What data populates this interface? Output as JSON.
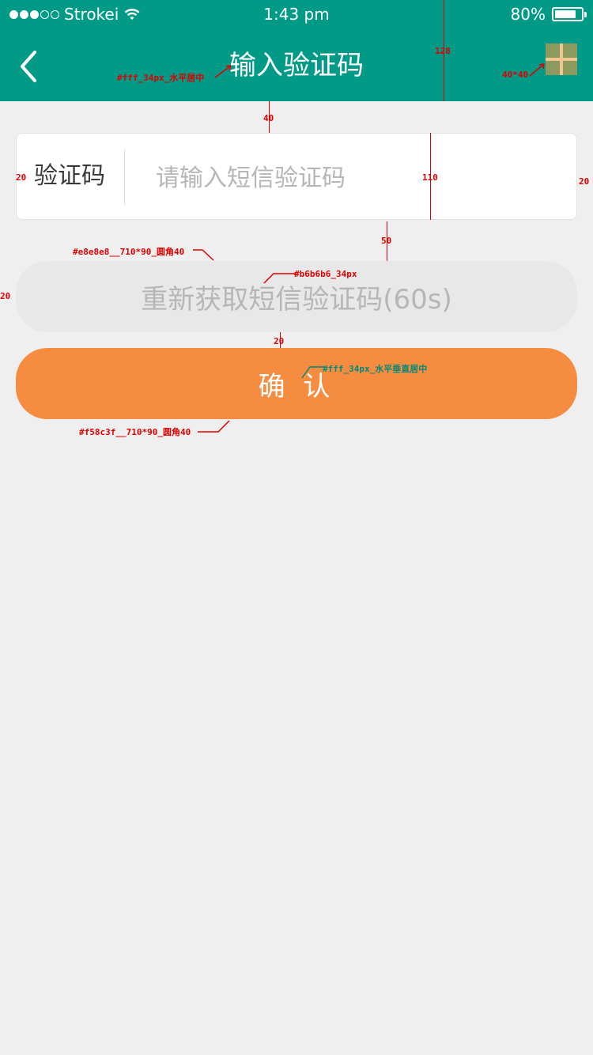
{
  "status_bar": {
    "carrier": "Strokei",
    "time": "1:43 pm",
    "battery": "80%",
    "battery_level": 0.8
  },
  "header": {
    "title": "输入验证码",
    "bg_color": "#009a87"
  },
  "form": {
    "code_label": "验证码",
    "code_placeholder": "请输入短信验证码",
    "code_value": ""
  },
  "buttons": {
    "resend_label": "重新获取短信验证码(60s)",
    "resend_color": "#e8e8e8",
    "confirm_label": "确 认",
    "confirm_color": "#f58c3f"
  },
  "annotations": {
    "title_note": "#fff_34px_水平居中",
    "header_height": "128",
    "icon_size": "40*40",
    "gap_40": "40",
    "left_pad": "20",
    "right_pad": "20",
    "row_height": "110",
    "gap_50": "50",
    "resend_spec": "#e8e8e8__710*90_圆角40",
    "resend_text_spec": "#b6b6b6_34px",
    "resend_left": "20",
    "gap_20": "20",
    "confirm_text_spec": "#fff_34px_水平垂直居中",
    "confirm_spec": "#f58c3f__710*90_圆角40"
  }
}
